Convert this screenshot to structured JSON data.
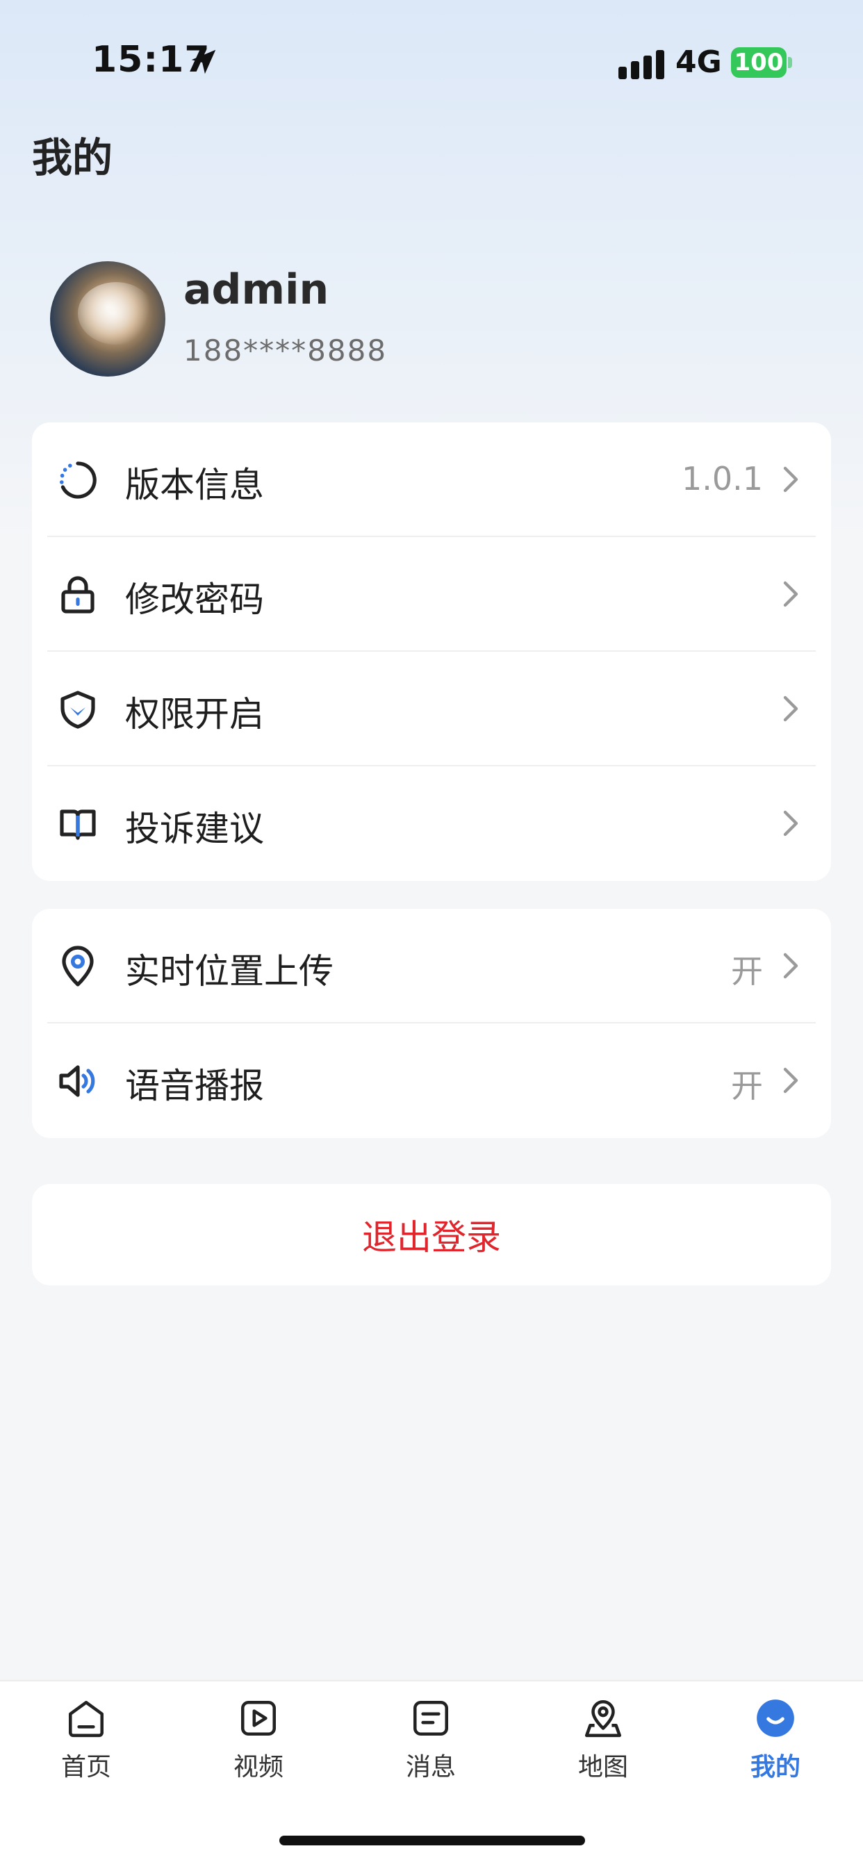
{
  "status_bar": {
    "time": "15:17",
    "network": "4G",
    "battery": "100"
  },
  "page": {
    "title": "我的"
  },
  "profile": {
    "username": "admin",
    "phone": "188****8888"
  },
  "menu_group_1": [
    {
      "label": "版本信息",
      "value": "1.0.1",
      "icon": "loading-circle-icon"
    },
    {
      "label": "修改密码",
      "value": "",
      "icon": "lock-icon"
    },
    {
      "label": "权限开启",
      "value": "",
      "icon": "shield-icon"
    },
    {
      "label": "投诉建议",
      "value": "",
      "icon": "book-icon"
    }
  ],
  "menu_group_2": [
    {
      "label": "实时位置上传",
      "value": "开",
      "icon": "location-pin-icon"
    },
    {
      "label": "语音播报",
      "value": "开",
      "icon": "speaker-icon"
    }
  ],
  "logout": {
    "label": "退出登录"
  },
  "tabbar": {
    "tabs": [
      {
        "label": "首页"
      },
      {
        "label": "视频"
      },
      {
        "label": "消息"
      },
      {
        "label": "地图"
      },
      {
        "label": "我的"
      }
    ],
    "active_index": 4
  },
  "colors": {
    "accent": "#3478e0",
    "danger": "#e0262c",
    "battery": "#34c759"
  }
}
